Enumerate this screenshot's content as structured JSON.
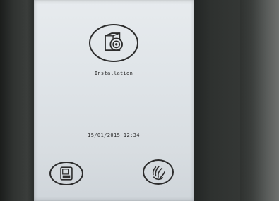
{
  "installation": {
    "label": "Installation",
    "icon": "camera-box-icon"
  },
  "status": {
    "datetime": "15/01/2015 12:34"
  },
  "bottom": {
    "left_icon": "door-panel-icon",
    "right_icon": "hand-wave-icon"
  },
  "colors": {
    "screen_bg": "#e2e6ea",
    "foreground": "#2a2a2a",
    "bezel": "#2b2e2c"
  }
}
